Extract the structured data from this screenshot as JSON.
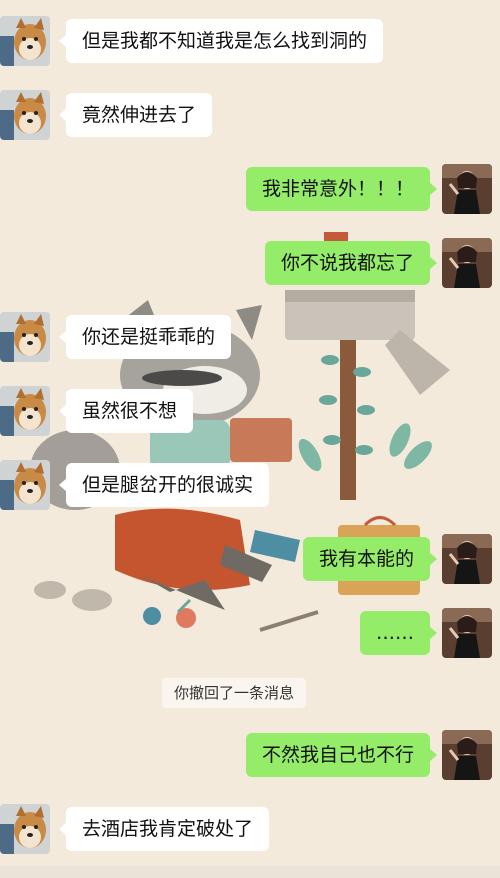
{
  "chat": {
    "messages": [
      {
        "from": "other",
        "text": "但是我都不知道我是怎么找到洞的"
      },
      {
        "from": "other",
        "text": "竟然伸进去了"
      },
      {
        "from": "me",
        "text": "我非常意外！！！"
      },
      {
        "from": "me",
        "text": "你不说我都忘了"
      },
      {
        "from": "other",
        "text": "你还是挺乖乖的"
      },
      {
        "from": "other",
        "text": "虽然很不想"
      },
      {
        "from": "other",
        "text": "但是腿岔开的很诚实"
      },
      {
        "from": "me",
        "text": "我有本能的"
      },
      {
        "from": "me",
        "text": "……"
      },
      {
        "from": "other",
        "text": "去酒店我肯定破处了"
      },
      {
        "from": "me",
        "text": "不然我自己也不行"
      }
    ],
    "system_notice": "你撤回了一条消息"
  },
  "avatars": {
    "other": "shiba-dog-avatar",
    "me": "woman-in-black-avatar"
  },
  "colors": {
    "background": "#f3eadc",
    "incoming_bubble": "#ffffff",
    "outgoing_bubble": "#95ec69"
  }
}
